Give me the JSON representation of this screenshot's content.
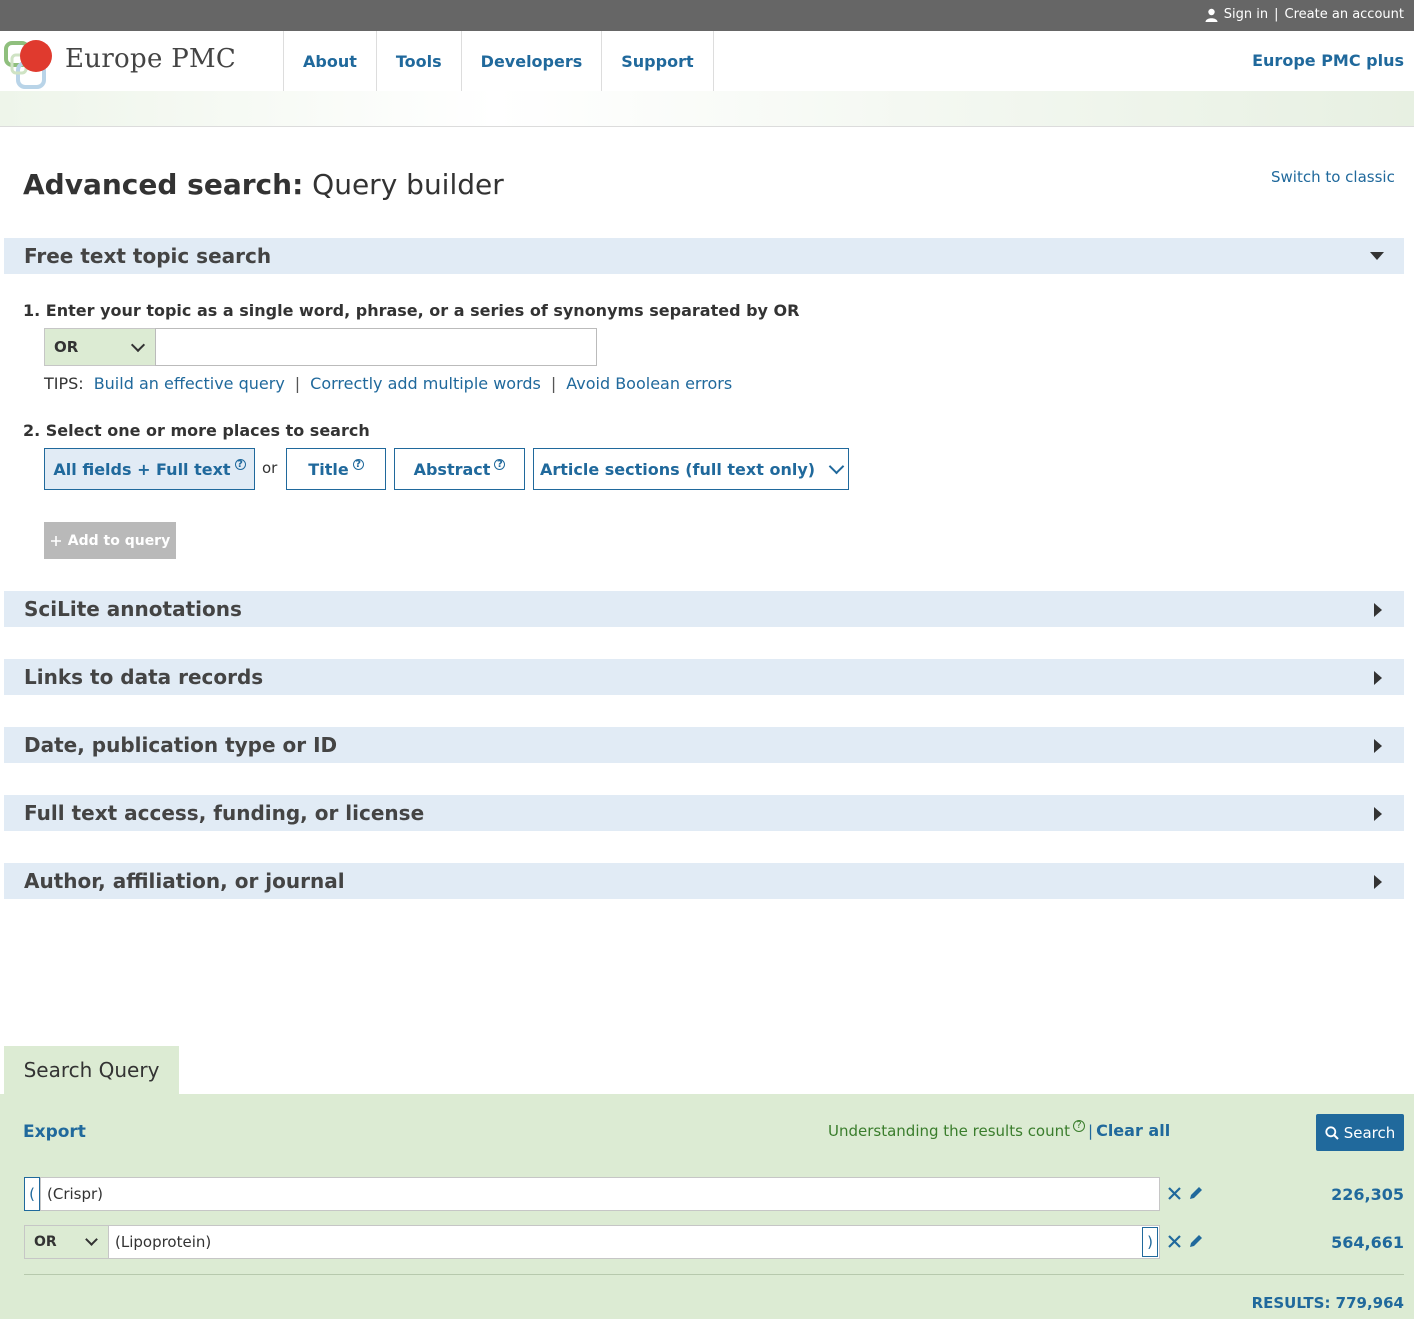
{
  "topbar": {
    "sign_in": "Sign in",
    "separator": "|",
    "create_account": "Create an account"
  },
  "header": {
    "logo_text": "Europe PMC",
    "nav": [
      "About",
      "Tools",
      "Developers",
      "Support"
    ],
    "plus_link": "Europe PMC plus"
  },
  "page": {
    "title_bold": "Advanced search:",
    "title_light": "Query builder",
    "switch_link": "Switch to classic"
  },
  "free_text": {
    "heading": "Free text topic search",
    "step1": "1. Enter your topic as a single word, phrase, or a series of synonyms separated by OR",
    "operator": "OR",
    "topic_value": "",
    "tips_label": "TIPS:",
    "tips": [
      "Build an effective query",
      "Correctly add multiple words",
      "Avoid Boolean errors"
    ],
    "tips_separator": "|",
    "step2": "2. Select one or more places to search",
    "places": {
      "all_fields": "All fields + Full text",
      "or_word": "or",
      "title": "Title",
      "abstract": "Abstract",
      "article_sections": "Article sections (full text only)"
    },
    "add_to_query": "Add to query"
  },
  "sections": [
    "SciLite annotations",
    "Links to data records",
    "Date, publication type or ID",
    "Full text access, funding, or license",
    "Author, affiliation, or journal"
  ],
  "search_query": {
    "tab_label": "Search Query",
    "export": "Export",
    "count_help": "Understanding the results count",
    "count_sep": "|",
    "clear_all": "Clear all",
    "search_button": "Search",
    "rows": [
      {
        "open_paren": "(",
        "text": "(Crispr)",
        "count": "226,305"
      },
      {
        "operator": "OR",
        "text": "(Lipoprotein)",
        "close_paren": ")",
        "count": "564,661"
      }
    ],
    "results": "RESULTS: 779,964"
  },
  "colors": {
    "link_blue": "#20699c",
    "section_bg": "#e1ebf5",
    "query_panel_bg": "#dcebd3",
    "topbar_bg": "#666666",
    "logo_red": "#e03a2e"
  }
}
